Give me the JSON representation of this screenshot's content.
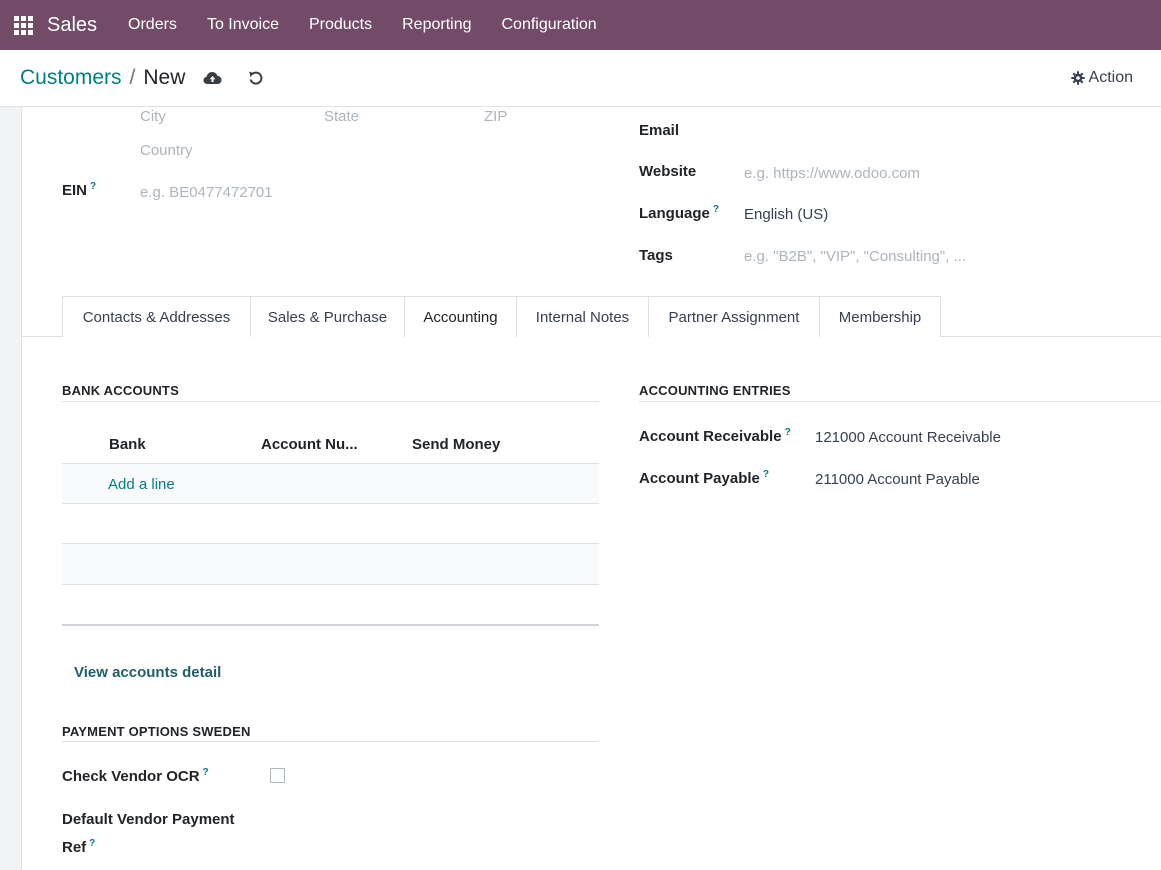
{
  "navbar": {
    "app_name": "Sales",
    "menu": [
      "Orders",
      "To Invoice",
      "Products",
      "Reporting",
      "Configuration"
    ]
  },
  "control": {
    "breadcrumb_parent": "Customers",
    "breadcrumb_sep": "/",
    "breadcrumb_current": "New",
    "action_label": "Action"
  },
  "address": {
    "city_placeholder": "City",
    "state_placeholder": "State",
    "zip_placeholder": "ZIP",
    "country_placeholder": "Country"
  },
  "ein": {
    "label": "EIN",
    "help": "?",
    "placeholder": "e.g. BE0477472701"
  },
  "right_fields": {
    "email_label": "Email",
    "website_label": "Website",
    "website_placeholder": "e.g. https://www.odoo.com",
    "language_label": "Language",
    "language_help": "?",
    "language_value": "English (US)",
    "tags_label": "Tags",
    "tags_placeholder": "e.g. \"B2B\", \"VIP\", \"Consulting\", ..."
  },
  "tabs": [
    "Contacts & Addresses",
    "Sales & Purchase",
    "Accounting",
    "Internal Notes",
    "Partner Assignment",
    "Membership"
  ],
  "active_tab": "Accounting",
  "bank_accounts": {
    "title": "BANK ACCOUNTS",
    "columns": [
      "Bank",
      "Account Nu...",
      "Send Money"
    ],
    "add_line": "Add a line",
    "view_detail": "View accounts detail"
  },
  "accounting_entries": {
    "title": "ACCOUNTING ENTRIES",
    "receivable_label": "Account Receivable",
    "receivable_help": "?",
    "receivable_value": "121000 Account Receivable",
    "payable_label": "Account Payable",
    "payable_help": "?",
    "payable_value": "211000 Account Payable"
  },
  "payment_sweden": {
    "title": "PAYMENT OPTIONS SWEDEN",
    "check_ocr_label": "Check Vendor OCR",
    "check_ocr_help": "?",
    "check_ocr_checked": false,
    "default_ref_label_line1": "Default Vendor Payment",
    "default_ref_label_line2": "Ref",
    "default_ref_help": "?"
  },
  "colors": {
    "navbar": "#714b67",
    "link": "#017e84"
  }
}
